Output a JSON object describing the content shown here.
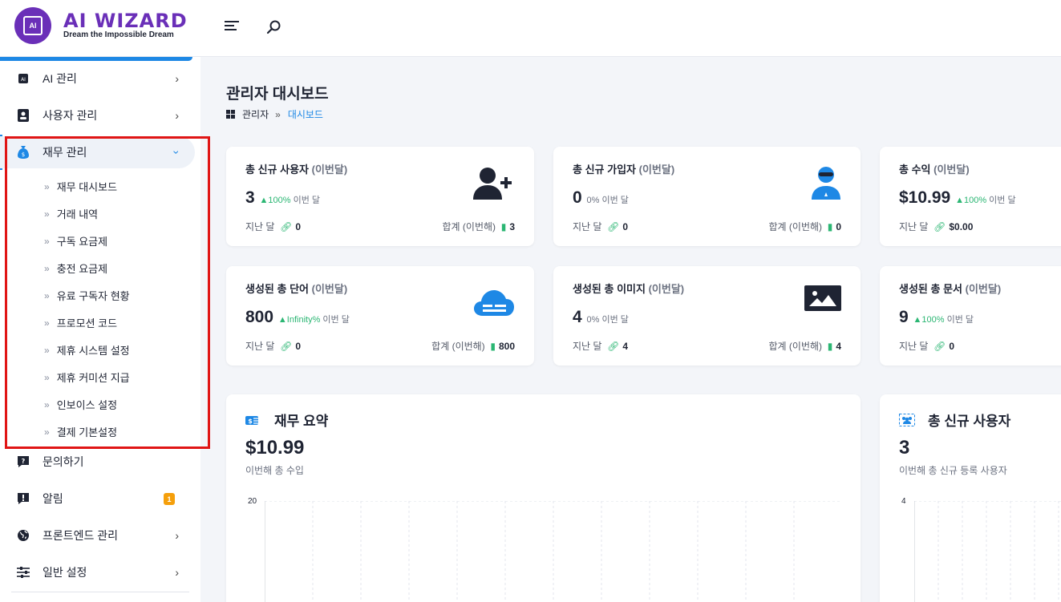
{
  "brand": {
    "name": "AI WIZARD",
    "tagline": "Dream the Impossible Dream",
    "chip_text": "AI"
  },
  "header": {
    "menu_icon": "hamburger-icon",
    "search_icon": "search-icon"
  },
  "sidebar": {
    "items": [
      {
        "label": "AI 관리",
        "icon": "ai-chip-icon"
      },
      {
        "label": "사용자 관리",
        "icon": "contact-card-icon"
      },
      {
        "label": "재무 관리",
        "icon": "money-bag-icon"
      },
      {
        "label": "문의하기",
        "icon": "question-bubble-icon"
      },
      {
        "label": "알림",
        "icon": "alert-bubble-icon",
        "badge": "1"
      },
      {
        "label": "프론트엔드 관리",
        "icon": "globe-icon"
      },
      {
        "label": "일반 설정",
        "icon": "sliders-icon"
      }
    ],
    "finance_sub": [
      "재무 대시보드",
      "거래 내역",
      "구독 요금제",
      "충전 요금제",
      "유료 구독자 현황",
      "프로모션 코드",
      "제휴 시스템 설정",
      "제휴 커미션 지급",
      "인보이스 설정",
      "결제 기본설정"
    ]
  },
  "page": {
    "title": "관리자 대시보드",
    "breadcrumb": {
      "root": "관리자",
      "sep": "»",
      "current": "대시보드"
    }
  },
  "cards": [
    {
      "title": "총 신규 사용자",
      "title_sub": "(이번달)",
      "value": "3",
      "pct": "100%",
      "pct_suffix": "이번 달",
      "trend": "up",
      "last_label": "지난 달",
      "last_value": "0",
      "total_label": "합계 (이번해)",
      "total_value": "3",
      "icon": "user-plus-icon"
    },
    {
      "title": "총 신규 가입자",
      "title_sub": "(이번달)",
      "value": "0",
      "pct": "0%",
      "pct_suffix": "이번 달",
      "trend": "none",
      "last_label": "지난 달",
      "last_value": "0",
      "total_label": "합계 (이번해)",
      "total_value": "0",
      "icon": "subscriber-icon"
    },
    {
      "title": "총 수익",
      "title_sub": "(이번달)",
      "value": "$10.99",
      "pct": "100%",
      "pct_suffix": "이번 달",
      "trend": "up",
      "last_label": "지난 달",
      "last_value": "$0.00",
      "total_label": "",
      "total_value": "",
      "icon": ""
    },
    {
      "title": "생성된 총 단어",
      "title_sub": "(이번달)",
      "value": "800",
      "pct": "Infinity%",
      "pct_suffix": "이번 달",
      "trend": "up",
      "last_label": "지난 달",
      "last_value": "0",
      "total_label": "합계 (이번해)",
      "total_value": "800",
      "icon": "cloud-icon"
    },
    {
      "title": "생성된 총 이미지",
      "title_sub": "(이번달)",
      "value": "4",
      "pct": "0%",
      "pct_suffix": "이번 달",
      "trend": "none",
      "last_label": "지난 달",
      "last_value": "4",
      "total_label": "합계 (이번해)",
      "total_value": "4",
      "icon": "image-icon"
    },
    {
      "title": "생성된 총 문서",
      "title_sub": "(이번달)",
      "value": "9",
      "pct": "100%",
      "pct_suffix": "이번 달",
      "trend": "up",
      "last_label": "지난 달",
      "last_value": "0",
      "total_label": "",
      "total_value": "",
      "icon": ""
    }
  ],
  "finance_summary": {
    "title": "재무 요약",
    "value": "$10.99",
    "sub": "이번해 총 수입",
    "y_max": "20",
    "icon": "money-transfer-icon"
  },
  "new_users": {
    "title": "총 신규 사용자",
    "value": "3",
    "sub": "이번해 총 신규 등록 사용자",
    "y_max": "4",
    "icon": "users-group-icon"
  },
  "colors": {
    "accent": "#1e88e5",
    "brand": "#6a2fb8",
    "up": "#2bb673",
    "highlight_box": "#e01515",
    "badge": "#f59f0b"
  }
}
